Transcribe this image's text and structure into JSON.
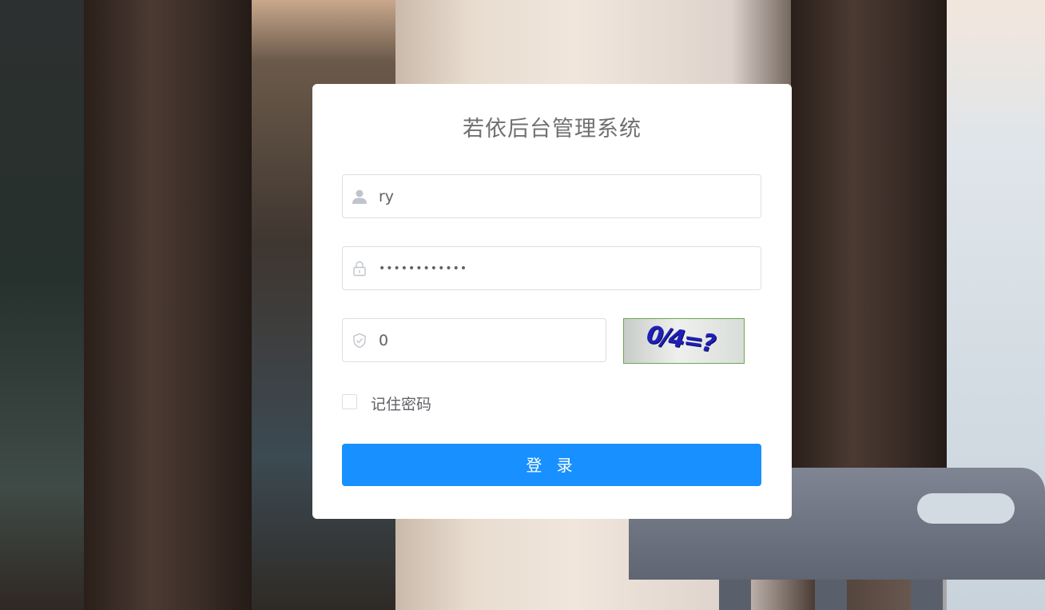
{
  "page": {
    "title": "若依后台管理系统"
  },
  "form": {
    "username": {
      "value": "ry",
      "icon": "user-icon"
    },
    "password": {
      "value": "admin1234567",
      "icon": "lock-icon"
    },
    "captcha": {
      "value": "0",
      "icon": "shield-check-icon",
      "image_text": "0/4=?"
    },
    "remember": {
      "label": "记住密码",
      "checked": false
    },
    "submit_label": "登 录"
  },
  "colors": {
    "primary": "#1890ff",
    "title_text": "#707070",
    "border": "#dcdfe6",
    "captcha_border": "#6aa84f",
    "captcha_text": "#1f1fb8"
  }
}
